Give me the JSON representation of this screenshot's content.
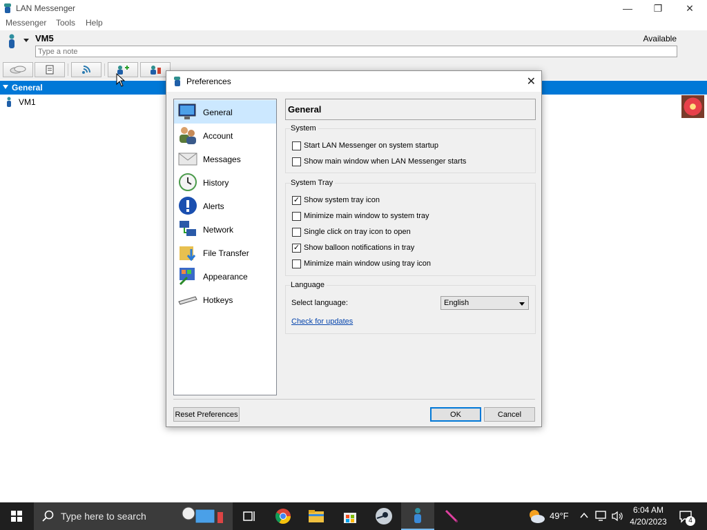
{
  "window": {
    "title": "LAN Messenger",
    "minimize_glyph": "—",
    "restore_glyph": "❐",
    "close_glyph": "✕"
  },
  "menu": [
    "Messenger",
    "Tools",
    "Help"
  ],
  "user": {
    "name": "VM5",
    "status": "Available",
    "note_placeholder": "Type a note"
  },
  "toolbar": {
    "icons": [
      "chat-bubbles-icon",
      "new-message-icon",
      "broadcast-icon",
      "add-users-icon",
      "transfer-users-icon"
    ]
  },
  "contacts": {
    "group": "General",
    "items": [
      {
        "name": "VM1"
      }
    ]
  },
  "dialog": {
    "title": "Preferences",
    "close_glyph": "✕",
    "nav": [
      {
        "label": "General",
        "icon": "monitor-icon",
        "selected": true
      },
      {
        "label": "Account",
        "icon": "users-icon"
      },
      {
        "label": "Messages",
        "icon": "envelope-icon"
      },
      {
        "label": "History",
        "icon": "clock-icon"
      },
      {
        "label": "Alerts",
        "icon": "alert-icon"
      },
      {
        "label": "Network",
        "icon": "network-icon"
      },
      {
        "label": "File Transfer",
        "icon": "folder-download-icon"
      },
      {
        "label": "Appearance",
        "icon": "palette-icon"
      },
      {
        "label": "Hotkeys",
        "icon": "keyboard-icon"
      }
    ],
    "panel_title": "General",
    "groups": {
      "system": {
        "label": "System",
        "options": [
          {
            "label": "Start LAN Messenger on system startup",
            "checked": false
          },
          {
            "label": "Show main window when LAN Messenger starts",
            "checked": false
          }
        ]
      },
      "tray": {
        "label": "System Tray",
        "options": [
          {
            "label": "Show system tray icon",
            "checked": true
          },
          {
            "label": "Minimize main window to system tray",
            "checked": false
          },
          {
            "label": "Single click on tray icon to open",
            "checked": false
          },
          {
            "label": "Show balloon notifications in tray",
            "checked": true
          },
          {
            "label": "Minimize main window using tray icon",
            "checked": false
          }
        ]
      },
      "language": {
        "label": "Language",
        "select_label": "Select language:",
        "selected": "English",
        "update_link": "Check for updates"
      }
    },
    "buttons": {
      "reset": "Reset Preferences",
      "ok": "OK",
      "cancel": "Cancel"
    },
    "check_glyph": "✓"
  },
  "taskbar": {
    "search_placeholder": "Type here to search",
    "weather": "49°F",
    "time": "6:04 AM",
    "date": "4/20/2023",
    "notification_count": "4",
    "apps": [
      "widgets-icon",
      "task-view-icon",
      "chrome-icon",
      "file-explorer-icon",
      "store-icon",
      "steam-icon",
      "lan-messenger-icon",
      "pen-app-icon"
    ]
  }
}
